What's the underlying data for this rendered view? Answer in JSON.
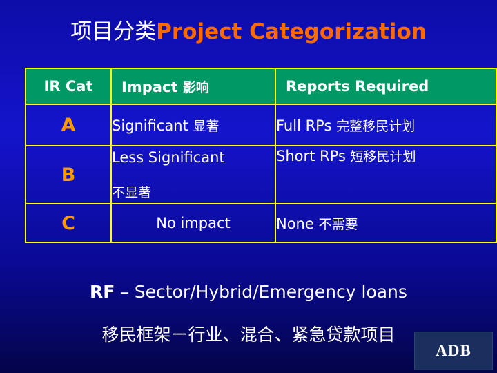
{
  "slide": {
    "title_cn": "项目分类",
    "title_en": "Project Categorization",
    "table": {
      "headers": {
        "cat": "IR Cat",
        "impact_en": "Impact",
        "impact_cn": "影响",
        "reports": "Reports Required"
      },
      "rows": [
        {
          "cat": "A",
          "impact_en": "Significant",
          "impact_cn": "显著",
          "impact_cn2": "",
          "reports_en": "Full RPs",
          "reports_cn": "完整移民计划"
        },
        {
          "cat": "B",
          "impact_en": "Less Significant",
          "impact_cn": "不显著",
          "impact_cn2": "",
          "reports_en": "Short RPs",
          "reports_cn": "短移民计划"
        },
        {
          "cat": "C",
          "impact_en": "No impact",
          "impact_cn": "",
          "impact_cn2": "",
          "reports_en": "None",
          "reports_cn": "不需要"
        }
      ]
    },
    "footer": {
      "rf_label": "RF",
      "rf_text": "– Sector/Hybrid/Emergency loans",
      "rf_cn": "移民框架－行业、混合、紧急贷款项目"
    },
    "logo": {
      "text": "ADB"
    }
  }
}
